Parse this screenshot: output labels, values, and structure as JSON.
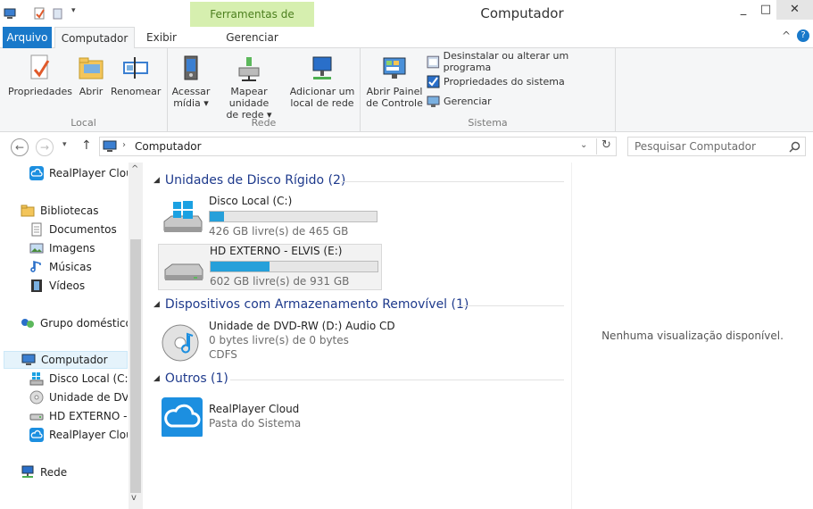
{
  "window": {
    "title": "Computador",
    "context_tab": "Ferramentas de Unidade",
    "minimize": "_",
    "maximize": "□",
    "close": "✕"
  },
  "tabs": {
    "file": "Arquivo",
    "computer": "Computador",
    "view": "Exibir",
    "manage": "Gerenciar"
  },
  "ribbon": {
    "local": {
      "label": "Local",
      "properties": "Propriedades",
      "open": "Abrir",
      "rename": "Renomear"
    },
    "network": {
      "label": "Rede",
      "access_media_1": "Acessar",
      "access_media_2": "mídia ▾",
      "map_drive_1": "Mapear unidade",
      "map_drive_2": "de rede ▾",
      "add_location_1": "Adicionar um",
      "add_location_2": "local de rede"
    },
    "system": {
      "label": "Sistema",
      "control_panel_1": "Abrir Painel",
      "control_panel_2": "de Controle",
      "uninstall": "Desinstalar ou alterar um programa",
      "system_props": "Propriedades do sistema",
      "manage": "Gerenciar"
    }
  },
  "address": {
    "path": "Computador",
    "search_placeholder": "Pesquisar Computador"
  },
  "nav": {
    "realplayer_top": "RealPlayer Cloud",
    "libraries": "Bibliotecas",
    "documents": "Documentos",
    "images": "Imagens",
    "music": "Músicas",
    "videos": "Vídeos",
    "homegroup": "Grupo doméstico",
    "computer": "Computador",
    "disk_c": "Disco Local (C:)",
    "dvd": "Unidade de DVD-",
    "hd_ext": "HD EXTERNO - E",
    "realplayer": "RealPlayer Cloud",
    "network": "Rede"
  },
  "content": {
    "hdd_section": "Unidades de Disco Rígido (2)",
    "removable_section": "Dispositivos com Armazenamento Removível (1)",
    "other_section": "Outros (1)",
    "drives": [
      {
        "name": "Disco Local (C:)",
        "free": "426 GB livre(s) de 465 GB",
        "used_fraction": 0.084
      },
      {
        "name": "HD EXTERNO - ELVIS (E:)",
        "free": "602 GB livre(s) de 931 GB",
        "used_fraction": 0.353
      }
    ],
    "dvd": {
      "name": "Unidade de DVD-RW (D:) Audio CD",
      "free": "0 bytes livre(s) de 0 bytes",
      "fs": "CDFS"
    },
    "other": {
      "name": "RealPlayer Cloud",
      "sub": "Pasta do Sistema"
    }
  },
  "preview": {
    "text": "Nenhuma visualização disponível."
  }
}
